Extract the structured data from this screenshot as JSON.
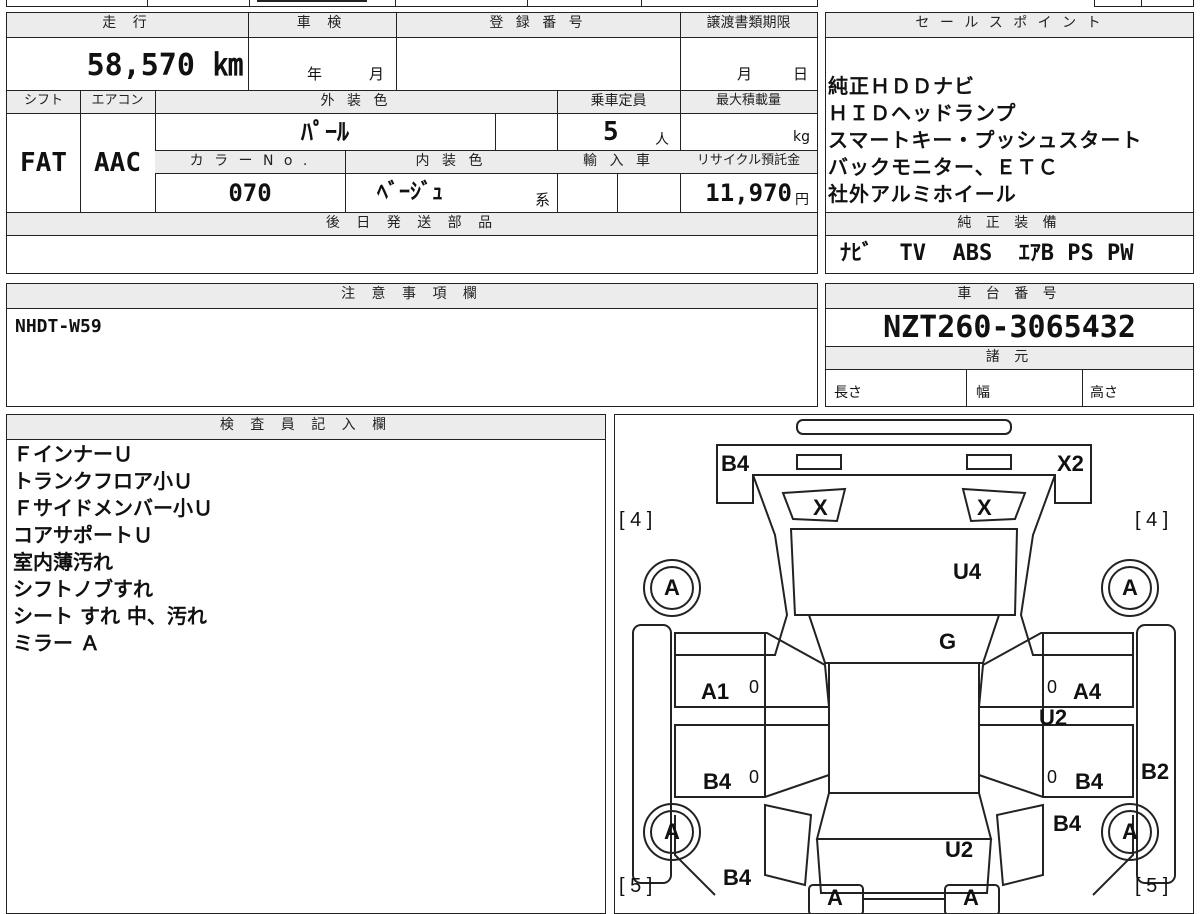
{
  "top_section": {
    "mileage_header": "走 行",
    "mileage_value": "58,570 ㎞",
    "shaken_header": "車 検",
    "shaken_year": "年",
    "shaken_month": "月",
    "registration_header": "登 録 番 号",
    "transfer_deadline_header": "譲渡書類期限",
    "transfer_month": "月",
    "transfer_day": "日"
  },
  "vehicle_specs": {
    "shift_header": "シフト",
    "shift_value": "FAT",
    "ac_header": "エアコン",
    "ac_value": "AAC",
    "exterior_color_header": "外 装 色",
    "exterior_color_value": "ﾊﾟｰﾙ",
    "capacity_header": "乗車定員",
    "capacity_value": "5",
    "capacity_unit": "人",
    "max_load_header": "最大積載量",
    "max_load_unit": "kg",
    "color_no_header": "カ ラ ー N o .",
    "color_no_value": "070",
    "interior_color_header": "内 装 色",
    "interior_color_value": "ﾍﾞｰｼﾞｭ",
    "interior_color_suffix": "系",
    "import_header": "輸 入 車",
    "recycle_header": "リサイクル預託金",
    "recycle_value": "11,970",
    "recycle_unit": "円"
  },
  "later_parts": {
    "header": "後 日 発 送 部 品"
  },
  "sales_points": {
    "header": "セ ー ル ス ポ イ ン ト",
    "items": [
      "純正ＨＤＤナビ",
      "ＨＩＤヘッドランプ",
      "スマートキー・プッシュスタート",
      "バックモニター、ＥＴＣ",
      "社外アルミホイール"
    ]
  },
  "genuine_equipment": {
    "header": "純 正 装 備",
    "items": [
      "ﾅﾋﾞ",
      "TV",
      "ABS",
      "ｴｱB",
      "PS",
      "PW"
    ]
  },
  "notes": {
    "header": "注 意 事 項 欄",
    "text": "NHDT-W59"
  },
  "chassis": {
    "header": "車 台 番 号",
    "value": "NZT260-3065432"
  },
  "dimensions": {
    "header": "諸 元",
    "length": "長さ",
    "width": "幅",
    "height": "高さ"
  },
  "inspector": {
    "header": "検 査 員 記 入 欄",
    "lines": [
      "ＦインナーＵ",
      "トランクフロア小Ｕ",
      "Ｆサイドメンバー小Ｕ",
      "コアサポートＵ",
      "室内薄汚れ",
      "シフトノブすれ",
      "シート すれ 中、汚れ",
      "ミラー Ａ"
    ]
  },
  "diagram": {
    "labels": {
      "rear_left": "B4",
      "rear_right": "X2",
      "rear_glass_left": "X",
      "rear_glass_right": "X",
      "tire_rear_left": "[ 4 ]",
      "tire_rear_right": "[ 4 ]",
      "wheel_rl": "A",
      "wheel_rr": "A",
      "trunk": "U4",
      "rear_window": "G",
      "door_rl": "A1",
      "door_rr": "A4",
      "sill_right": "U2",
      "door_fl": "B4",
      "door_fr": "B4",
      "fender_right": "B2",
      "bumper_fr": "B4",
      "wheel_fl": "A",
      "wheel_fr": "A",
      "hood": "U2",
      "front_left": "B4",
      "tire_front_left": "[ 5 ]",
      "tire_front_right": "[ 5 ]",
      "mirror_left": "A",
      "mirror_right": "A",
      "zero_a": "0",
      "zero_b": "0",
      "zero_c": "0",
      "zero_d": "0"
    }
  }
}
